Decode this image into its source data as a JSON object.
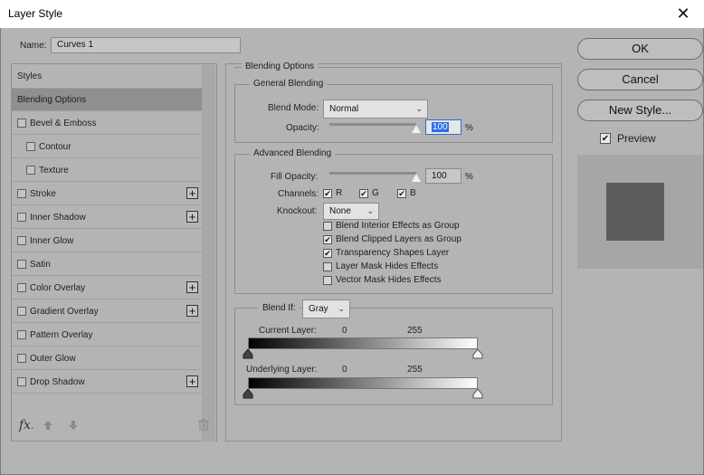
{
  "window": {
    "title": "Layer Style",
    "close_glyph": "✕"
  },
  "name_field": {
    "label": "Name:",
    "value": "Curves 1"
  },
  "styles_list": {
    "header": "Styles",
    "items": [
      {
        "label": "Blending Options",
        "selected": true,
        "checkbox": false,
        "plus": false,
        "indent": 0
      },
      {
        "label": "Bevel & Emboss",
        "checkbox": true,
        "plus": false,
        "indent": 0
      },
      {
        "label": "Contour",
        "checkbox": true,
        "plus": false,
        "indent": 1
      },
      {
        "label": "Texture",
        "checkbox": true,
        "plus": false,
        "indent": 1
      },
      {
        "label": "Stroke",
        "checkbox": true,
        "plus": true,
        "indent": 0
      },
      {
        "label": "Inner Shadow",
        "checkbox": true,
        "plus": true,
        "indent": 0
      },
      {
        "label": "Inner Glow",
        "checkbox": true,
        "plus": false,
        "indent": 0
      },
      {
        "label": "Satin",
        "checkbox": true,
        "plus": false,
        "indent": 0
      },
      {
        "label": "Color Overlay",
        "checkbox": true,
        "plus": true,
        "indent": 0
      },
      {
        "label": "Gradient Overlay",
        "checkbox": true,
        "plus": true,
        "indent": 0
      },
      {
        "label": "Pattern Overlay",
        "checkbox": true,
        "plus": false,
        "indent": 0
      },
      {
        "label": "Outer Glow",
        "checkbox": true,
        "plus": false,
        "indent": 0
      },
      {
        "label": "Drop Shadow",
        "checkbox": true,
        "plus": true,
        "indent": 0
      }
    ],
    "footer": {
      "fx_label": "fx",
      "fx_suffix": "."
    }
  },
  "blending": {
    "section_title": "Blending Options",
    "general": {
      "title": "General Blending",
      "blend_mode_label": "Blend Mode:",
      "blend_mode_value": "Normal",
      "opacity_label": "Opacity:",
      "opacity_value": "100",
      "opacity_unit": "%",
      "opacity_level": 1.0
    },
    "advanced": {
      "title": "Advanced Blending",
      "fill_opacity_label": "Fill Opacity:",
      "fill_opacity_value": "100",
      "fill_opacity_unit": "%",
      "fill_level": 1.0,
      "channels_label": "Channels:",
      "channels": [
        {
          "label": "R",
          "checked": true
        },
        {
          "label": "G",
          "checked": true
        },
        {
          "label": "B",
          "checked": true
        }
      ],
      "knockout_label": "Knockout:",
      "knockout_value": "None",
      "options": [
        {
          "label": "Blend Interior Effects as Group",
          "checked": false
        },
        {
          "label": "Blend Clipped Layers as Group",
          "checked": true
        },
        {
          "label": "Transparency Shapes Layer",
          "checked": true
        },
        {
          "label": "Layer Mask Hides Effects",
          "checked": false
        },
        {
          "label": "Vector Mask Hides Effects",
          "checked": false
        }
      ]
    },
    "blend_if": {
      "label": "Blend If:",
      "value": "Gray",
      "current_layer": {
        "label": "Current Layer:",
        "low": "0",
        "high": "255"
      },
      "underlying_layer": {
        "label": "Underlying Layer:",
        "low": "0",
        "high": "255"
      }
    }
  },
  "buttons": {
    "ok": "OK",
    "cancel": "Cancel",
    "new_style": "New Style..."
  },
  "preview": {
    "label": "Preview",
    "checked": true
  },
  "check_glyph": "✔",
  "chevron_glyph": "⌄",
  "plus_glyph": "+"
}
